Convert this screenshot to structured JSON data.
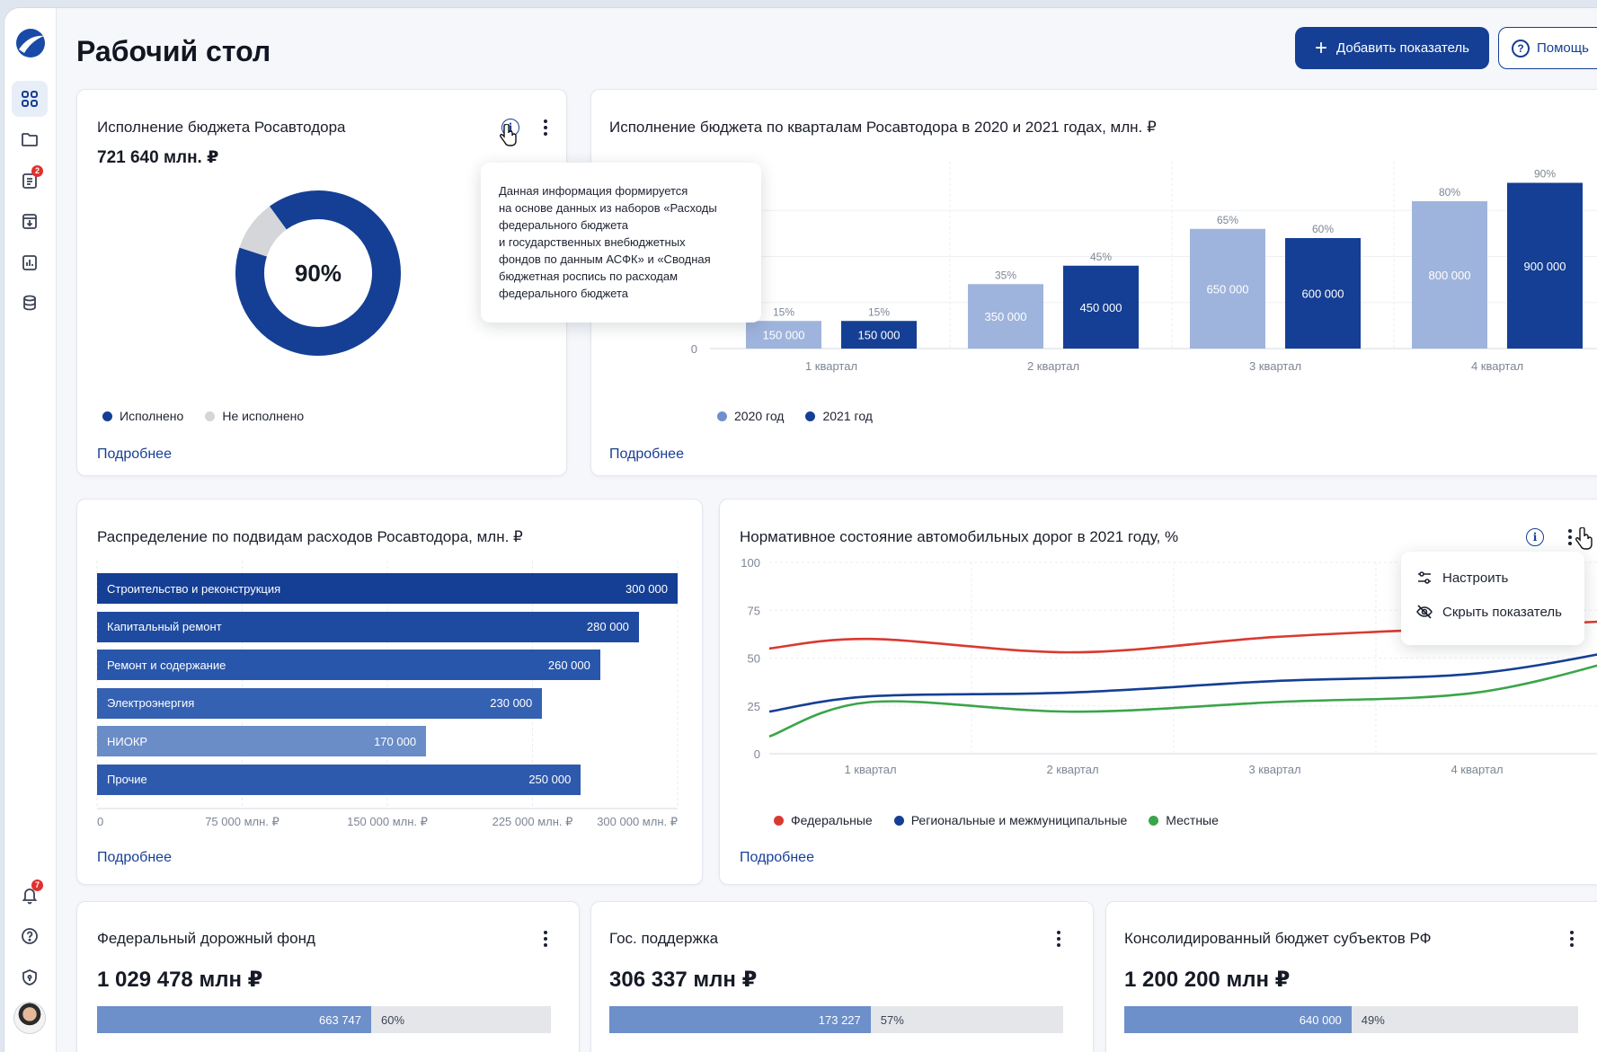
{
  "page": {
    "title": "Рабочий стол"
  },
  "header": {
    "add_button": "Добавить показатель",
    "help_button": "Помощь"
  },
  "sidebar": {
    "items": [
      {
        "name": "dashboard",
        "icon": "grid-icon"
      },
      {
        "name": "folders",
        "icon": "folder-icon"
      },
      {
        "name": "tasks",
        "icon": "clipboard-icon",
        "badge": "2"
      },
      {
        "name": "archive",
        "icon": "archive-download-icon"
      },
      {
        "name": "reports",
        "icon": "bar-chart-icon"
      },
      {
        "name": "database",
        "icon": "database-icon"
      }
    ],
    "bottom": [
      {
        "name": "notifications",
        "icon": "bell-icon",
        "badge": "7"
      },
      {
        "name": "help",
        "icon": "question-icon"
      },
      {
        "name": "security",
        "icon": "shield-icon"
      }
    ]
  },
  "budget_card": {
    "title": "Исполнение бюджета Росавтодора",
    "value": "721 640 млн. ₽",
    "center_label": "90%",
    "legend": [
      "Исполнено",
      "Не исполнено"
    ],
    "more": "Подробнее",
    "tooltip": "Данная информация формируется\nна основе данных из наборов «Расходы\nфедерального бюджета\nи государственных внебюджетных\nфондов по данным АСФК» и «Сводная\nбюджетная роспись по расходам\nфедерального бюджета"
  },
  "quarter_card": {
    "title": "Исполнение бюджета по кварталам Росавтодора в 2020 и 2021 годах, млн. ₽",
    "legend": [
      "2020 год",
      "2021 год"
    ],
    "more": "Подробнее"
  },
  "subtypes_card": {
    "title": "Распределение по подвидам расходов Росавтодора, млн. ₽",
    "more": "Подробнее"
  },
  "roads_card": {
    "title": "Нормативное состояние автомобильных дорог в 2021 году, %",
    "more": "Подробнее",
    "menu": [
      "Настроить",
      "Скрыть показатель"
    ]
  },
  "bottom_cards": [
    {
      "title": "Федеральный дорожный фонд",
      "value": "1 029 478 млн ₽",
      "bar_value": "663 747",
      "bar_pct_label": "60%",
      "fraction": 0.6
    },
    {
      "title": "Гос. поддержка",
      "value": "306 337 млн ₽",
      "bar_value": "173 227",
      "bar_pct_label": "57%",
      "fraction": 0.57
    },
    {
      "title": "Консолидированный бюджет субъектов РФ",
      "value": "1 200 200 млн ₽",
      "bar_value": "640 000",
      "bar_pct_label": "49%",
      "fraction": 0.49
    }
  ],
  "colors": {
    "primary": "#153f94",
    "light_blue": "#9fb4dc",
    "red": "#d93a2f",
    "green": "#3aa54a",
    "gray": "#d4d6da"
  },
  "chart_data": [
    {
      "type": "pie",
      "title": "Исполнение бюджета Росавтодора",
      "slices": [
        {
          "name": "Исполнено",
          "value": 90
        },
        {
          "name": "Не исполнено",
          "value": 10
        }
      ]
    },
    {
      "type": "bar",
      "title": "Исполнение бюджета по кварталам Росавтодора в 2020 и 2021 годах, млн. ₽",
      "categories": [
        "1 квартал",
        "2 квартал",
        "3 квартал",
        "4 квартал"
      ],
      "series": [
        {
          "name": "2020 год",
          "values": [
            150000,
            350000,
            650000,
            800000
          ],
          "labels": [
            "150 000",
            "350 000",
            "650 000",
            "800 000"
          ],
          "percent": [
            "15%",
            "35%",
            "65%",
            "80%"
          ]
        },
        {
          "name": "2021 год",
          "values": [
            150000,
            450000,
            600000,
            900000
          ],
          "labels": [
            "150 000",
            "450 000",
            "600 000",
            "900 000"
          ],
          "percent": [
            "15%",
            "45%",
            "60%",
            "90%"
          ]
        }
      ],
      "y_ticks": [
        "0"
      ],
      "ylim": [
        0,
        1000000
      ]
    },
    {
      "type": "bar",
      "orientation": "horizontal",
      "title": "Распределение по подвидам расходов Росавтодора, млн. ₽",
      "categories": [
        "Строительство и реконструкция",
        "Капитальный ремонт",
        "Ремонт и содержание",
        "Электроэнергия",
        "НИОКР",
        "Прочие"
      ],
      "values": [
        300000,
        280000,
        260000,
        230000,
        170000,
        250000
      ],
      "labels": [
        "300 000",
        "280 000",
        "260 000",
        "230 000",
        "170 000",
        "250 000"
      ],
      "x_ticks": [
        "0",
        "75 000 млн. ₽",
        "150 000 млн. ₽",
        "225 000 млн. ₽",
        "300 000 млн. ₽"
      ],
      "xlim": [
        0,
        300000
      ]
    },
    {
      "type": "line",
      "title": "Нормативное состояние автомобильных дорог в 2021 году, %",
      "categories": [
        "1 квартал",
        "2 квартал",
        "3 квартал",
        "4 квартал"
      ],
      "x": [
        0,
        0.5,
        1.5,
        2.5,
        3.5,
        4.3
      ],
      "series": [
        {
          "name": "Федеральные",
          "values": [
            55,
            60,
            53,
            61,
            66,
            70
          ]
        },
        {
          "name": "Региональные и межмуниципальные",
          "values": [
            22,
            30,
            32,
            38,
            42,
            56
          ]
        },
        {
          "name": "Местные",
          "values": [
            9,
            27,
            22,
            27,
            32,
            52
          ]
        }
      ],
      "y_ticks": [
        "0",
        "25",
        "50",
        "75",
        "100"
      ],
      "ylim": [
        0,
        100
      ]
    }
  ]
}
